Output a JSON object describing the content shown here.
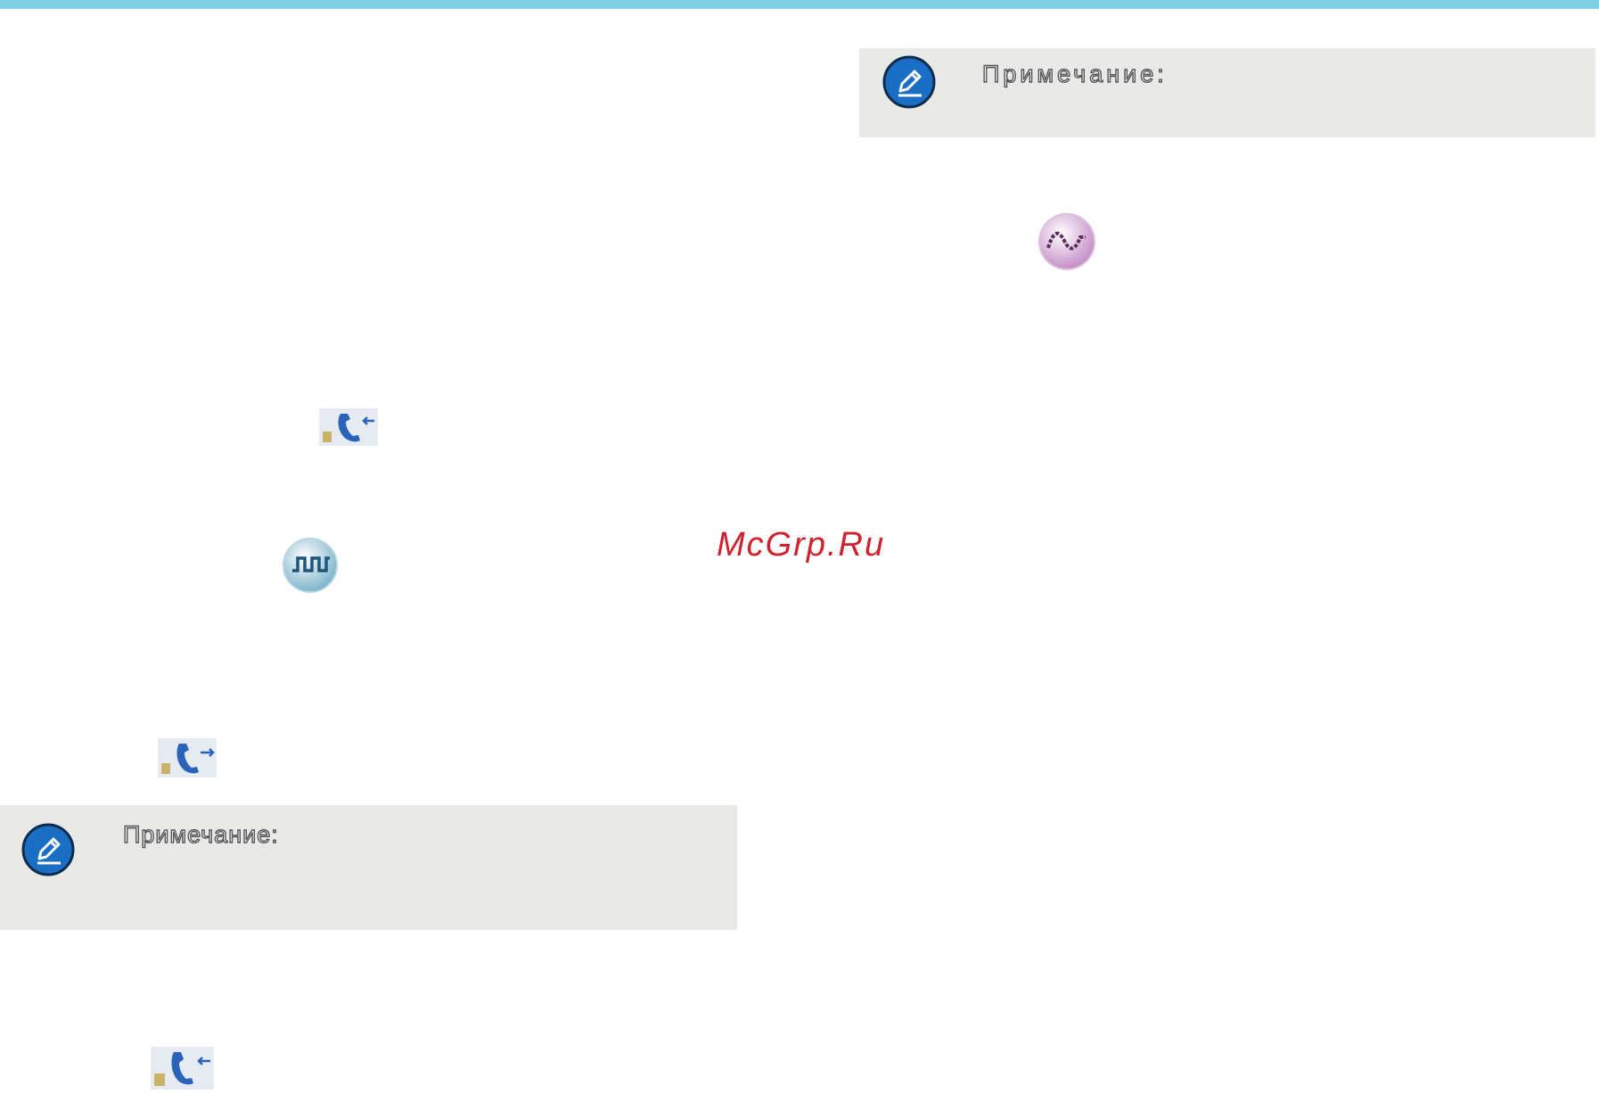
{
  "notes": {
    "top_right_label": "Примечание:",
    "bottom_left_label": "Примечание:"
  },
  "watermark": "McGrp.Ru",
  "icons": {
    "note": "pencil-note-icon",
    "call_in": "incoming-call-icon",
    "call_out": "outgoing-call-icon",
    "digital": "digital-mode-icon",
    "analog": "analog-mode-icon"
  },
  "colors": {
    "top_bar": "#7fd1e6",
    "note_background": "#e9e9e8",
    "note_icon": "#1a6fc4",
    "watermark": "#d0222e",
    "digital_icon": "#a9d4e3",
    "analog_icon": "#e3c4e4"
  }
}
